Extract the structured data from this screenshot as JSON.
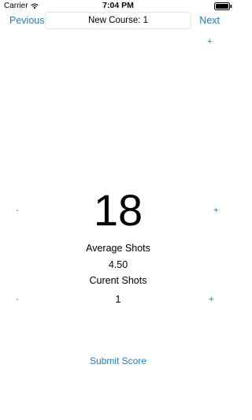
{
  "status_bar": {
    "carrier": "Carrier",
    "time": "7:04 PM"
  },
  "nav": {
    "previous_label": "Pevious",
    "next_label": "Next",
    "course_value": "New Course: 1"
  },
  "score": {
    "par_value": "18",
    "par_plus_label": "+",
    "par_minus_label": "-",
    "par_top_plus_label": "+",
    "average_label": "Average Shots",
    "average_value": "4.50",
    "current_label": "Curent Shots",
    "current_value": "1",
    "current_minus_label": "-",
    "current_plus_label": "+"
  },
  "actions": {
    "submit_label": "Submit Score"
  },
  "colors": {
    "accent": "#1a7fd4"
  }
}
